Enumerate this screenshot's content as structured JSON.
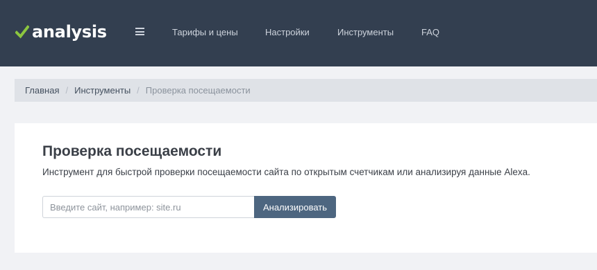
{
  "header": {
    "logo_text": "analysis",
    "logo_check_color": "#8cc63f",
    "background": "#333f50",
    "menu_icon": "hamburger-menu-icon",
    "nav": [
      {
        "label": "Тарифы и цены"
      },
      {
        "label": "Настройки"
      },
      {
        "label": "Инструменты"
      },
      {
        "label": "FAQ"
      }
    ]
  },
  "breadcrumb": {
    "items": [
      {
        "label": "Главная",
        "link": true
      },
      {
        "label": "Инструменты",
        "link": true
      },
      {
        "label": "Проверка посещаемости",
        "link": false
      }
    ],
    "separator": "/"
  },
  "main": {
    "title": "Проверка посещаемости",
    "description": "Инструмент для быстрой проверки посещаемости сайта по открытым счетчикам или анализируя данные Alexa.",
    "search": {
      "value": "",
      "placeholder": "Введите сайт, например: site.ru"
    },
    "analyze_button": "Анализировать",
    "button_color": "#4d6680"
  }
}
